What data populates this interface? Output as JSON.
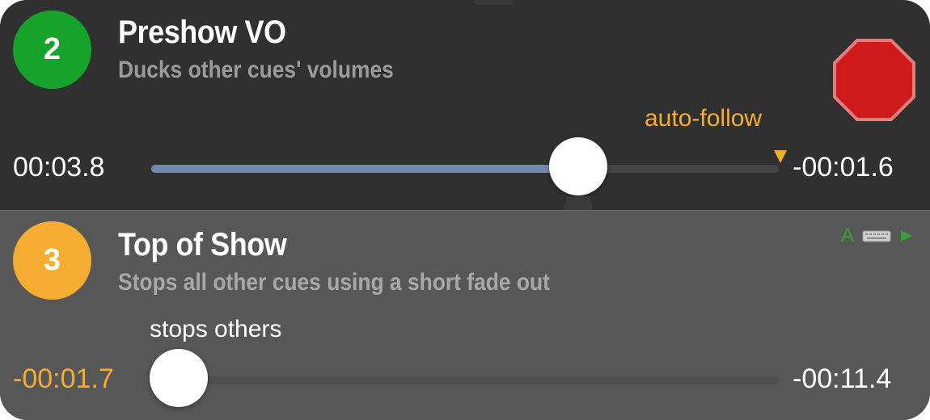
{
  "colors": {
    "panel_top_bg": "#303030",
    "panel_bottom_bg": "#575757",
    "cue_2_badge": "#17a22c",
    "cue_3_badge": "#f4ac31",
    "accent_orange": "#f4ac31",
    "progress_fill": "#7389ad",
    "stop_red": "#cf1b1b",
    "stop_outline": "#e27d7d",
    "status_green": "#3f9e3a",
    "white": "#ffffff"
  },
  "cues": [
    {
      "number": "2",
      "title": "Preshow VO",
      "subtitle": "Ducks other cues' volumes",
      "follow_label": "auto-follow",
      "elapsed": "00:03.8",
      "remaining": "-00:01.6",
      "progress": 0.68,
      "stop_icon": "stop-icon"
    },
    {
      "number": "3",
      "title": "Top of Show",
      "subtitle": "Stops all other cues using a short fade out",
      "behavior_label": "stops others",
      "elapsed": "-00:01.7",
      "remaining": "-00:11.4",
      "progress": 0.0,
      "status": {
        "letter": "A",
        "icons": [
          "keyboard-icon",
          "play-icon"
        ]
      }
    }
  ]
}
